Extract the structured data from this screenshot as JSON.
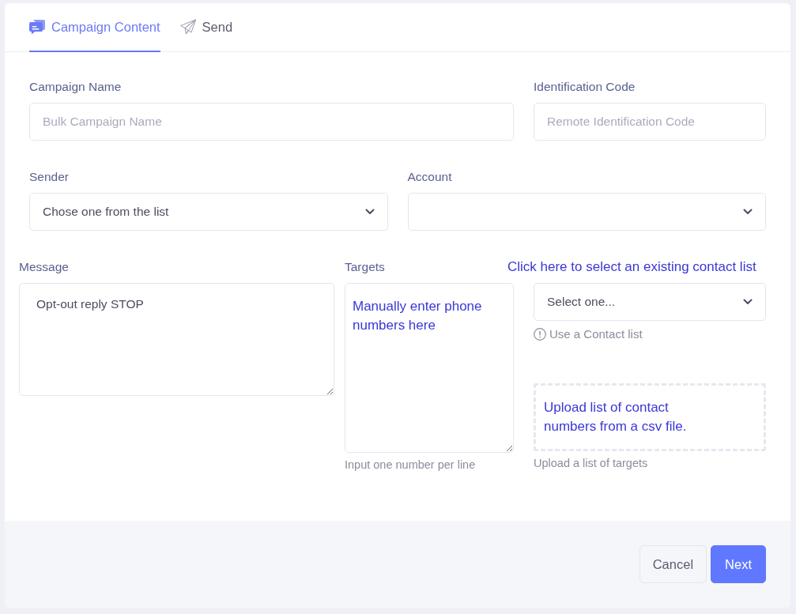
{
  "tabs": [
    {
      "label": "Campaign Content",
      "selected": true
    },
    {
      "label": "Send",
      "selected": false
    }
  ],
  "rows": [
    [
      {
        "kind": "input",
        "label": "Campaign Name",
        "placeholder": "Bulk Campaign Name"
      },
      {
        "kind": "input",
        "label": "Identification Code",
        "placeholder": "Remote Identification Code"
      }
    ],
    [
      {
        "kind": "select",
        "label": "Sender",
        "value": "Chose one from the list"
      },
      {
        "kind": "select",
        "label": "Account"
      }
    ]
  ],
  "message": {
    "label": "Message",
    "value": "Opt-out reply STOP"
  },
  "targets": {
    "label": "Targets",
    "annotation": "Manually enter phone numbers here",
    "hint": "Input one number per line"
  },
  "contact_list": {
    "annotation": "Click here to select an existing contact list",
    "value": "Select one...",
    "note": "Use a Contact list"
  },
  "upload": {
    "annotation": "Upload list of contact numbers from a csv file.",
    "hint": "Upload a list of targets"
  },
  "buttons": [
    {
      "label": "Cancel",
      "kind": "secondary"
    },
    {
      "label": "Next",
      "kind": "primary"
    }
  ]
}
